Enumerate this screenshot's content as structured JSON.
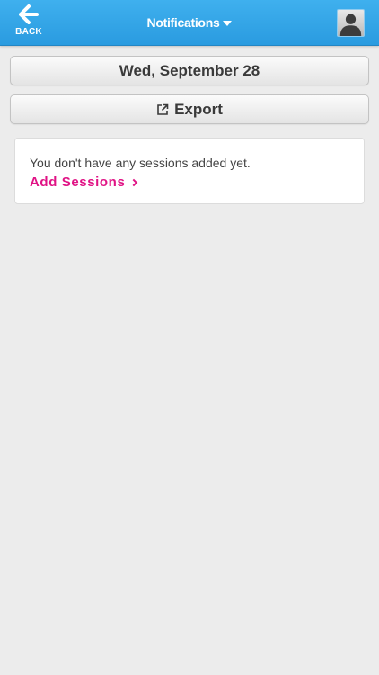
{
  "header": {
    "back_label": "BACK",
    "title": "Notifications"
  },
  "date_button": {
    "label": "Wed, September 28"
  },
  "export_button": {
    "label": "Export"
  },
  "sessions_card": {
    "empty_message": "You don't have any sessions added yet.",
    "add_link_label": "Add Sessions"
  },
  "colors": {
    "header_blue": "#2fa4e7",
    "accent_pink": "#e01385",
    "page_background": "#ececec"
  }
}
